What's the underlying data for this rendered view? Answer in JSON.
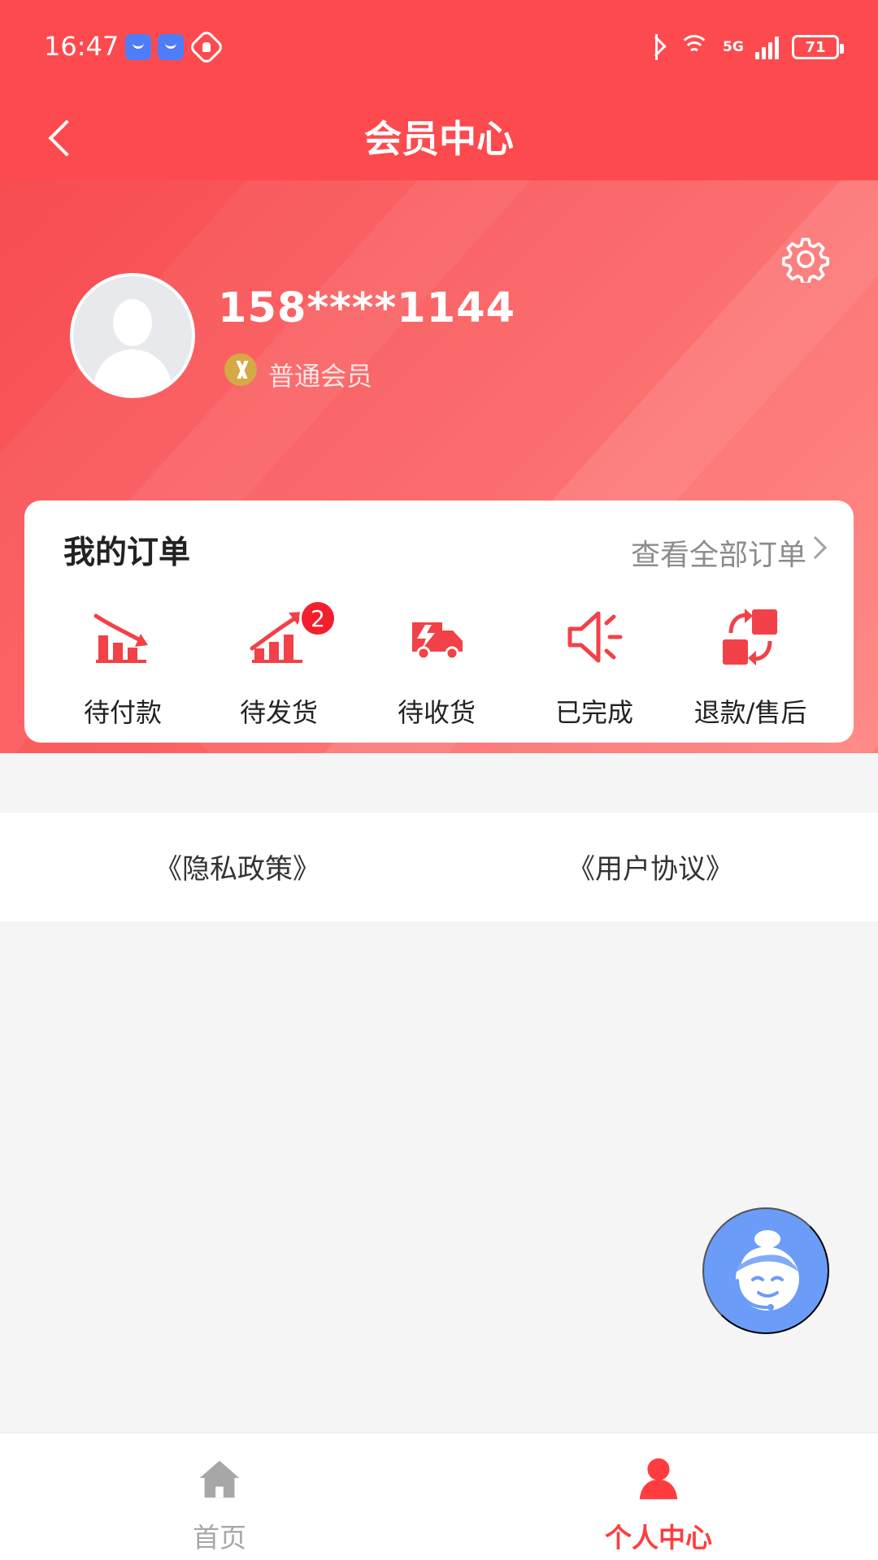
{
  "status_bar": {
    "time": "16:47",
    "network": "5G",
    "battery": "71",
    "icons": [
      "baidu-app-icon",
      "baidu-app-icon",
      "hand-icon",
      "bluetooth-icon",
      "wifi-icon",
      "signal-icon",
      "battery-icon"
    ]
  },
  "nav": {
    "title": "会员中心",
    "back_icon": "chevron-left-icon"
  },
  "profile": {
    "phone": "158****1144",
    "member_level": "普通会员",
    "settings_icon": "gear-icon",
    "avatar_icon": "user-silhouette-icon",
    "vip_icon": "vip-badge-icon"
  },
  "orders": {
    "title": "我的订单",
    "view_all": "查看全部订单",
    "items": [
      {
        "label": "待付款",
        "icon": "falling-chart-icon"
      },
      {
        "label": "待发货",
        "icon": "rising-chart-icon",
        "badge": "2"
      },
      {
        "label": "待收货",
        "icon": "delivery-truck-icon"
      },
      {
        "label": "已完成",
        "icon": "speaker-icon"
      },
      {
        "label": "退款/售后",
        "icon": "refund-swap-icon"
      }
    ]
  },
  "agreements": {
    "privacy": "《隐私政策》",
    "user": "《用户协议》"
  },
  "support": {
    "icon": "customer-service-icon"
  },
  "bottom_nav": {
    "home": "首页",
    "profile": "个人中心",
    "home_icon": "home-icon",
    "profile_icon": "person-icon"
  },
  "colors": {
    "primary_red": "#fd4a4e",
    "active_tab": "#ff3d3f",
    "support_blue": "#6b9cf7",
    "gold_badge": "#d4a946"
  }
}
